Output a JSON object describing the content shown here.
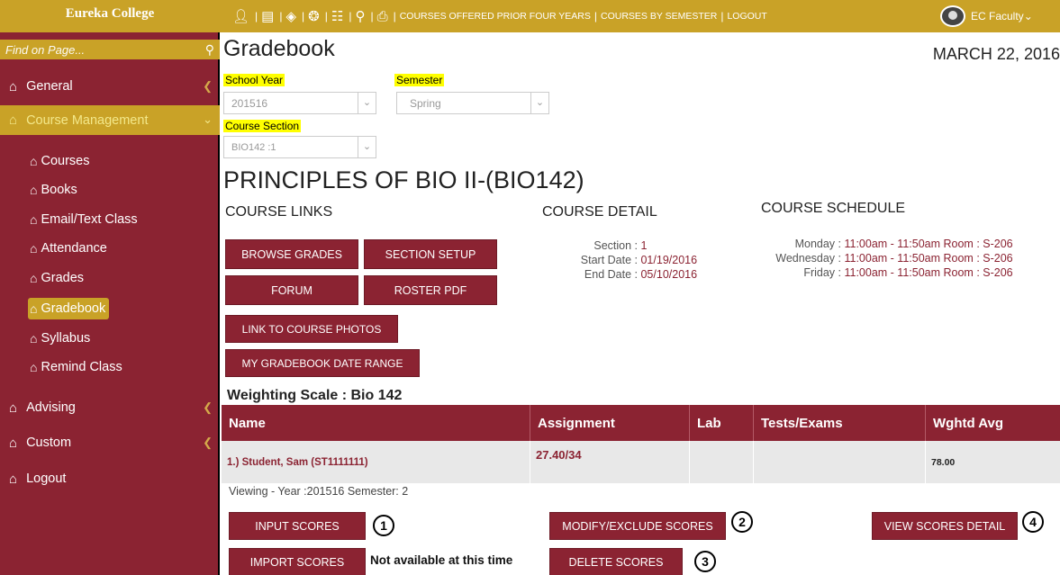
{
  "brand": "Eureka College",
  "topnav": {
    "icons": [
      "person-icon",
      "book-icon",
      "eraser-icon",
      "award-icon",
      "org-chart-icon",
      "search-icon",
      "printer-icon"
    ],
    "links": [
      "COURSES OFFERED PRIOR FOUR YEARS",
      "COURSES BY SEMESTER",
      "LOGOUT"
    ],
    "user": "EC Faculty"
  },
  "sidebar": {
    "find_placeholder": "Find on Page...",
    "items": [
      {
        "label": "General"
      },
      {
        "label": "Course Management"
      },
      {
        "label": "Advising"
      },
      {
        "label": "Custom"
      },
      {
        "label": "Logout"
      }
    ],
    "sub_items": [
      {
        "label": "Courses"
      },
      {
        "label": "Books"
      },
      {
        "label": "Email/Text Class"
      },
      {
        "label": "Attendance"
      },
      {
        "label": "Grades"
      },
      {
        "label": "Gradebook"
      },
      {
        "label": "Syllabus"
      },
      {
        "label": "Remind Class"
      }
    ],
    "colors": {
      "sidebar": "#8b2332",
      "accent": "#c9a227"
    }
  },
  "main": {
    "title": "Gradebook",
    "date": "MARCH 22, 2016",
    "filters": {
      "school_year_label": "School Year",
      "school_year_value": "201516",
      "semester_label": "Semester",
      "semester_value": "Spring",
      "course_section_label": "Course Section",
      "course_section_value": "BIO142 :1"
    },
    "course_title": "PRINCIPLES OF BIO II-(BIO142)",
    "course_links": {
      "heading": "COURSE LINKS",
      "buttons": [
        "BROWSE GRADES",
        "SECTION SETUP",
        "FORUM",
        "ROSTER PDF",
        "LINK TO COURSE PHOTOS",
        "MY GRADEBOOK DATE RANGE"
      ]
    },
    "course_detail": {
      "heading": "COURSE DETAIL",
      "section_label": "Section :",
      "section_value": "1",
      "start_label": "Start Date :",
      "start_value": "01/19/2016",
      "end_label": "End Date :",
      "end_value": "05/10/2016"
    },
    "course_schedule": {
      "heading": "COURSE SCHEDULE",
      "rows": [
        {
          "day": "Monday :",
          "value": "11:00am - 11:50am  Room : S-206"
        },
        {
          "day": "Wednesday :",
          "value": "11:00am - 11:50am  Room : S-206"
        },
        {
          "day": "Friday :",
          "value": "11:00am - 11:50am  Room : S-206"
        }
      ]
    },
    "weighting": {
      "title": "Weighting Scale : Bio 142",
      "columns": [
        "Name",
        "Assignment",
        "Lab",
        "Tests/Exams",
        "Wghtd Avg"
      ],
      "rows": [
        {
          "name": "1.) Student, Sam (ST1111111)",
          "assignment": "27.40/34",
          "lab": "",
          "tests": "",
          "avg": "78.00"
        }
      ]
    },
    "viewing": "Viewing - Year :201516 Semester: 2",
    "actions": {
      "input_scores": "INPUT SCORES",
      "modify_scores": "MODIFY/EXCLUDE SCORES",
      "view_detail": "VIEW SCORES DETAIL",
      "import_scores": "IMPORT SCORES",
      "not_available": "Not available at this time",
      "delete_scores": "DELETE SCORES",
      "callouts": [
        "1",
        "2",
        "3",
        "4"
      ]
    }
  }
}
